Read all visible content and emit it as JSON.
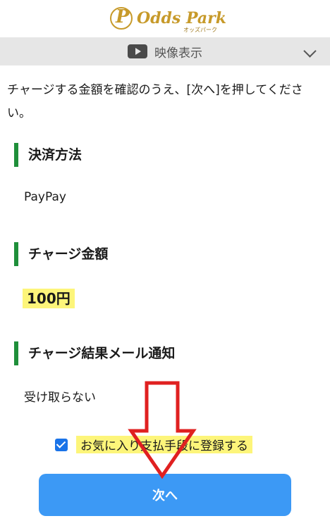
{
  "header": {
    "logo_text": "Odds Park",
    "logo_sub": "オッズパーク"
  },
  "video_bar": {
    "label": "映像表示",
    "icon": "video-play-icon"
  },
  "intro": "チャージする金額を確認のうえ、[次へ]を押してください。",
  "sections": [
    {
      "title": "決済方法",
      "value": "PayPay"
    },
    {
      "title": "チャージ金額",
      "value": "100円"
    },
    {
      "title": "チャージ結果メール通知",
      "value": "受け取らない"
    }
  ],
  "favorite": {
    "label": "お気に入り支払手段に登録する",
    "checked": true
  },
  "next_button": {
    "label": "次へ"
  },
  "colors": {
    "accent": "#3c99f5",
    "section_bar": "#1f8f3a",
    "highlight": "#fdf57a",
    "arrow": "#e02020"
  }
}
